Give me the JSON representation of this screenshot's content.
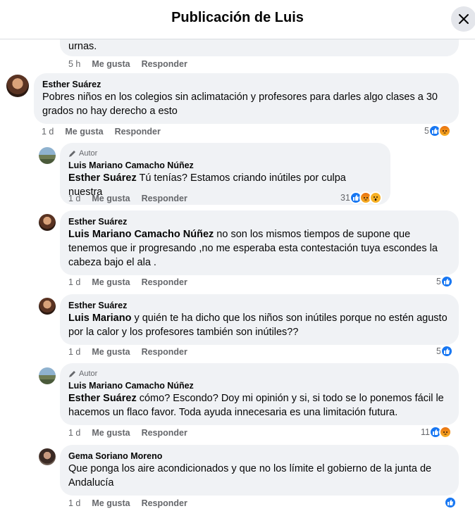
{
  "header": {
    "title": "Publicación de Luis"
  },
  "colors": {
    "like": "#1877f2",
    "angry": "#e9710f",
    "wow": "#f7b125",
    "bubble": "#f0f2f5"
  },
  "actions": {
    "like": "Me gusta",
    "reply": "Responder",
    "author_badge": "Autor"
  },
  "comments": [
    {
      "text": "urnas.",
      "time": "5 h"
    },
    {
      "name": "Esther Suárez",
      "text": "Pobres niños en los colegios sin aclimatación y profesores para darles algo clases a 30 grados no hay derecho a esto",
      "time": "1 d",
      "reaction_count": "5"
    },
    {
      "name": "Luis Mariano Camacho Núñez",
      "mention": "Esther Suárez",
      "text": " Tú tenías? Estamos criando inútiles por culpa nuestra",
      "time": "1 d",
      "reaction_count": "31"
    },
    {
      "name": "Esther Suárez",
      "mention": "Luis Mariano Camacho Núñez",
      "text": " no son los mismos tiempos de supone que tenemos que ir progresando ,no me esperaba esta contestación tuya escondes la cabeza bajo el ala .",
      "time": "1 d",
      "reaction_count": "5"
    },
    {
      "name": "Esther Suárez",
      "mention": "Luis Mariano",
      "text": " y quién te ha dicho que los niños son inútiles porque no estén agusto por la calor y los profesores también son inútiles??",
      "time": "1 d",
      "reaction_count": "5"
    },
    {
      "name": "Luis Mariano Camacho Núñez",
      "mention": "Esther Suárez",
      "text": " cómo? Escondo? Doy mi opinión y si, si todo se lo ponemos fácil le hacemos un flaco favor. Toda ayuda innecesaria es una limitación futura.",
      "time": "1 d",
      "reaction_count": "11"
    },
    {
      "name": "Gema Soriano Moreno",
      "text": "Que ponga los aire acondicionados y que no los límite el gobierno de la junta de Andalucía",
      "time": "1 d"
    }
  ]
}
